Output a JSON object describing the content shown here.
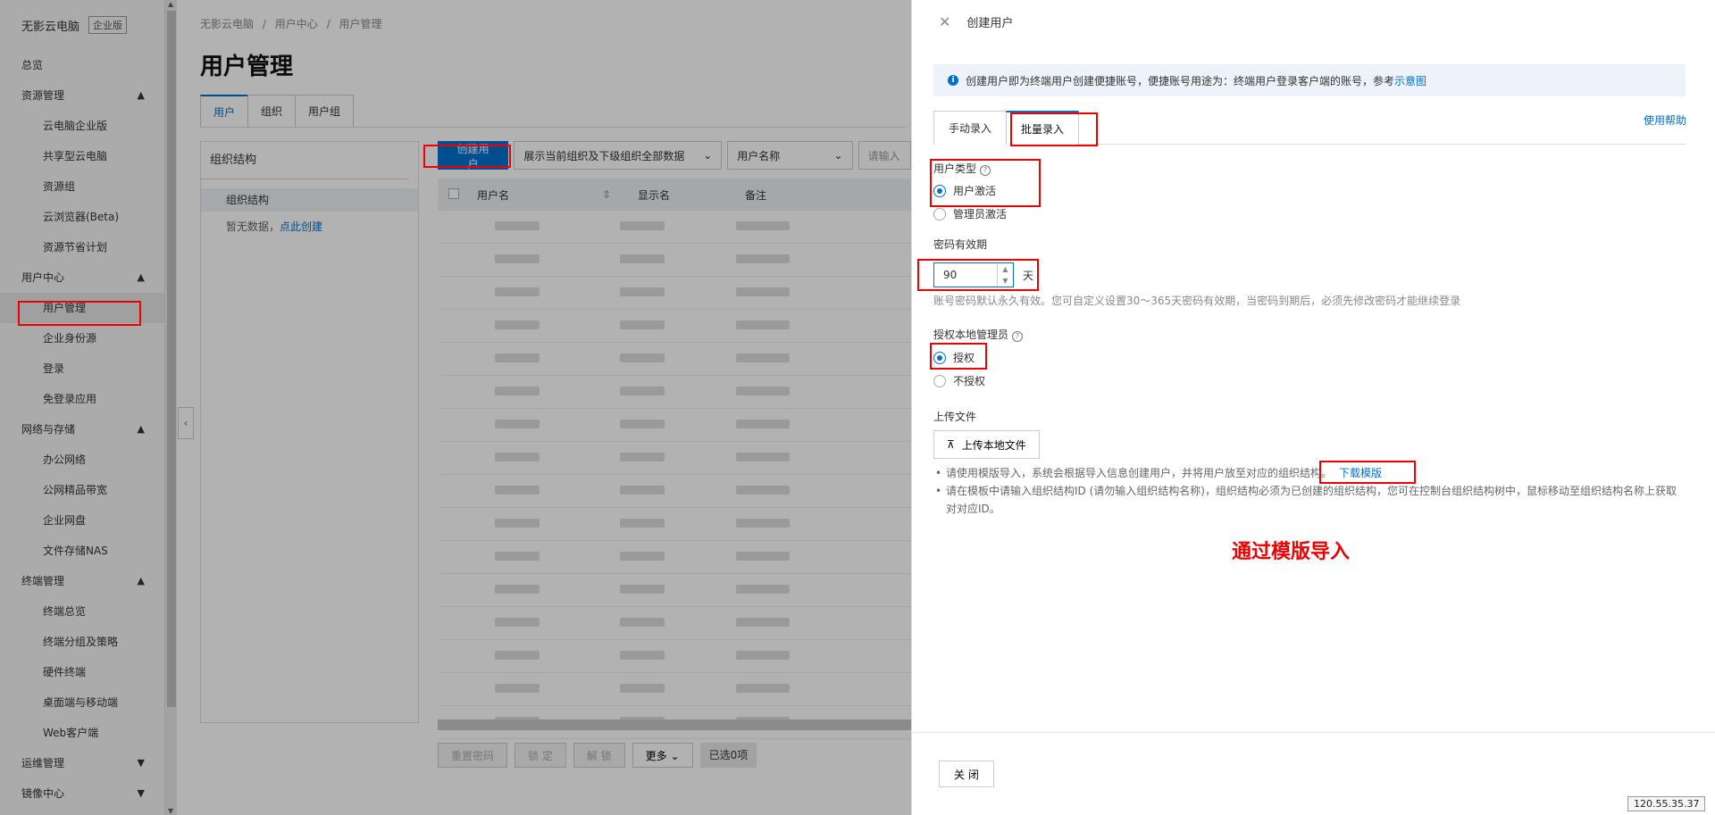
{
  "sidebar": {
    "brand": "无影云电脑",
    "edition": "企业版",
    "items": [
      {
        "label": "总览",
        "type": "top"
      },
      {
        "label": "资源管理",
        "type": "group",
        "chevron": "up"
      },
      {
        "label": "云电脑企业版",
        "type": "sub"
      },
      {
        "label": "共享型云电脑",
        "type": "sub"
      },
      {
        "label": "资源组",
        "type": "sub"
      },
      {
        "label": "云浏览器(Beta)",
        "type": "sub"
      },
      {
        "label": "资源节省计划",
        "type": "sub"
      },
      {
        "label": "用户中心",
        "type": "group",
        "chevron": "up"
      },
      {
        "label": "用户管理",
        "type": "sub",
        "active": true
      },
      {
        "label": "企业身份源",
        "type": "sub"
      },
      {
        "label": "登录",
        "type": "sub"
      },
      {
        "label": "免登录应用",
        "type": "sub"
      },
      {
        "label": "网络与存储",
        "type": "group",
        "chevron": "up"
      },
      {
        "label": "办公网络",
        "type": "sub"
      },
      {
        "label": "公网精品带宽",
        "type": "sub"
      },
      {
        "label": "企业网盘",
        "type": "sub"
      },
      {
        "label": "文件存储NAS",
        "type": "sub"
      },
      {
        "label": "终端管理",
        "type": "group",
        "chevron": "up"
      },
      {
        "label": "终端总览",
        "type": "sub"
      },
      {
        "label": "终端分组及策略",
        "type": "sub"
      },
      {
        "label": "硬件终端",
        "type": "sub"
      },
      {
        "label": "桌面端与移动端",
        "type": "sub"
      },
      {
        "label": "Web客户端",
        "type": "sub"
      },
      {
        "label": "运维管理",
        "type": "group",
        "chevron": "down"
      },
      {
        "label": "镜像中心",
        "type": "group",
        "chevron": "down"
      }
    ]
  },
  "main": {
    "breadcrumb": [
      "无影云电脑",
      "/",
      "用户中心",
      "/",
      "用户管理"
    ],
    "title": "用户管理",
    "tabs": [
      "用户",
      "组织",
      "用户组"
    ],
    "org_panel": {
      "title": "组织结构",
      "node": "组织结构",
      "empty_text": "暂无数据，",
      "empty_link": "点此创建"
    },
    "toolbar": {
      "create_btn": "创建用户",
      "scope_select": "展示当前组织及下级组织全部数据",
      "field_select": "用户名称",
      "search_placeholder": "请输入"
    },
    "table": {
      "columns": [
        "用户名",
        "显示名",
        "备注"
      ]
    },
    "bottom": {
      "reset": "重置密码",
      "lock": "锁 定",
      "unlock": "解 锁",
      "more": "更多",
      "selected": "已选0项"
    }
  },
  "drawer": {
    "title": "创建用户",
    "info": "创建用户即为终端用户创建便捷账号，便捷账号用途为：终端用户登录客户端的账号，参考",
    "info_link": "示意图",
    "tabs": [
      "手动录入",
      "批量录入"
    ],
    "help": "使用帮助",
    "user_type_label": "用户类型",
    "user_type_options": [
      "用户激活",
      "管理员激活"
    ],
    "pw_label": "密码有效期",
    "pw_value": "90",
    "pw_unit": "天",
    "pw_hint": "账号密码默认永久有效。您可自定义设置30～365天密码有效期，当密码到期后，必须先修改密码才能继续登录",
    "local_admin_label": "授权本地管理员",
    "local_admin_options": [
      "授权",
      "不授权"
    ],
    "upload_label": "上传文件",
    "upload_btn": "上传本地文件",
    "bullet1": "请使用模版导入，系统会根据导入信息创建用户，并将用户放至对应的组织结构。",
    "bullet1_link": "下载模版",
    "bullet2": "请在模板中请输入组织结构ID (请勿输入组织结构名称)，组织结构必须为已创建的组织结构，您可在控制台组织结构树中，鼠标移动至组织结构名称上获取对对应ID。",
    "annotation": "通过模版导入",
    "close": "关 闭"
  },
  "ip_tag": "120.55.35.37"
}
